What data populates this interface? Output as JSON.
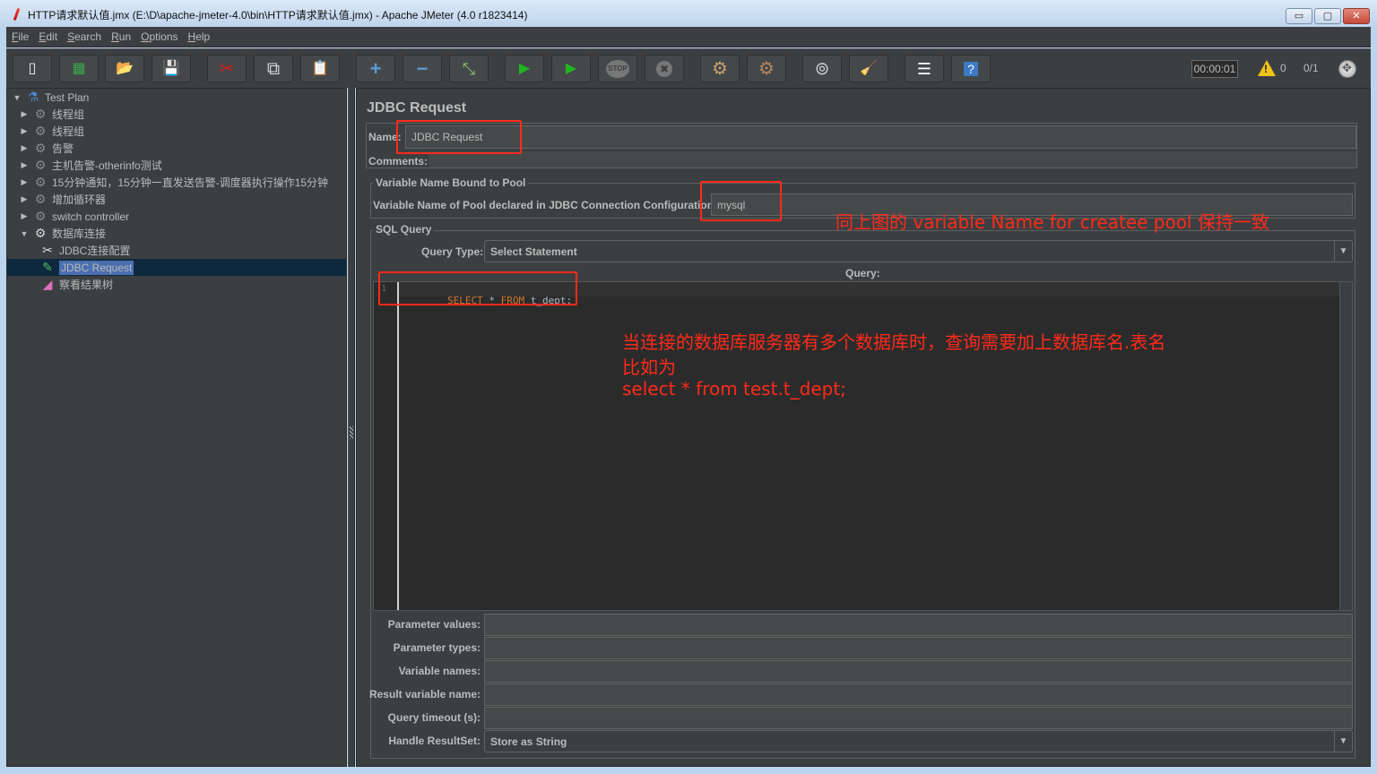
{
  "window": {
    "title": "HTTP请求默认值.jmx (E:\\D\\apache-jmeter-4.0\\bin\\HTTP请求默认值.jmx) - Apache JMeter (4.0 r1823414)",
    "controls": {
      "minimize": "▭",
      "maximize": "▢",
      "close": "✕"
    }
  },
  "menubar": {
    "items": [
      {
        "mnemonic": "F",
        "rest": "ile"
      },
      {
        "mnemonic": "E",
        "rest": "dit"
      },
      {
        "mnemonic": "S",
        "rest": "earch"
      },
      {
        "mnemonic": "R",
        "rest": "un"
      },
      {
        "mnemonic": "O",
        "rest": "ptions"
      },
      {
        "mnemonic": "H",
        "rest": "elp"
      }
    ]
  },
  "toolbar": {
    "buttons": [
      {
        "name": "new-icon",
        "glyph": "▯"
      },
      {
        "name": "templates-icon",
        "glyph": "▦"
      },
      {
        "name": "open-icon",
        "glyph": "📂"
      },
      {
        "name": "save-icon",
        "glyph": "💾"
      },
      {
        "name": "cut-icon",
        "glyph": "✂"
      },
      {
        "name": "copy-icon",
        "glyph": "⧉"
      },
      {
        "name": "paste-icon",
        "glyph": "📋"
      },
      {
        "name": "expand-icon",
        "glyph": "+"
      },
      {
        "name": "collapse-icon",
        "glyph": "−"
      },
      {
        "name": "toggle-icon",
        "glyph": "⤡"
      },
      {
        "name": "start-icon",
        "glyph": "▶"
      },
      {
        "name": "start-no-pauses-icon",
        "glyph": "▶"
      },
      {
        "name": "stop-icon",
        "glyph": "STOP"
      },
      {
        "name": "shutdown-icon",
        "glyph": "✖"
      },
      {
        "name": "clear-icon",
        "glyph": "⚙"
      },
      {
        "name": "clear-all-icon",
        "glyph": "⚙"
      },
      {
        "name": "search-icon",
        "glyph": "⊚"
      },
      {
        "name": "reset-search-icon",
        "glyph": "🧹"
      },
      {
        "name": "function-helper-icon",
        "glyph": "☰"
      },
      {
        "name": "help-icon",
        "glyph": "?"
      }
    ],
    "timer": "00:00:01",
    "warning_count": "0",
    "threads": "0/1"
  },
  "tree": {
    "items": [
      {
        "label": "Test Plan",
        "level": 0,
        "toggle": "▼",
        "icon": "flask-icon"
      },
      {
        "label": "线程组",
        "level": 1,
        "toggle": "▶",
        "icon": "gear-icon"
      },
      {
        "label": "线程组",
        "level": 1,
        "toggle": "▶",
        "icon": "gear-icon"
      },
      {
        "label": "告警",
        "level": 1,
        "toggle": "▶",
        "icon": "gear-icon"
      },
      {
        "label": "主机告警-otherinfo测试",
        "level": 1,
        "toggle": "▶",
        "icon": "gear-icon"
      },
      {
        "label": "15分钟通知，15分钟一直发送告警-调度器执行操作15分钟",
        "level": 1,
        "toggle": "▶",
        "icon": "gear-icon"
      },
      {
        "label": "增加循环器",
        "level": 1,
        "toggle": "▶",
        "icon": "gear-icon"
      },
      {
        "label": "switch controller",
        "level": 1,
        "toggle": "▶",
        "icon": "gear-icon"
      },
      {
        "label": "数据库连接",
        "level": 1,
        "toggle": "▼",
        "icon": "gear-icon"
      },
      {
        "label": "JDBC连接配置",
        "level": 2,
        "toggle": "",
        "icon": "wrench-icon"
      },
      {
        "label": "JDBC Request",
        "level": 2,
        "toggle": "",
        "icon": "pipette-icon",
        "selected": true
      },
      {
        "label": "察看结果树",
        "level": 2,
        "toggle": "",
        "icon": "chart-icon"
      }
    ]
  },
  "form": {
    "title": "JDBC Request",
    "name_label": "Name:",
    "name_value": "JDBC Request",
    "comments_label": "Comments:",
    "comments_value": "",
    "pool_section": "Variable Name Bound to Pool",
    "pool_label": "Variable Name of Pool declared in JDBC Connection Configuration:",
    "pool_value": "mysql",
    "sql_section": "SQL Query",
    "query_type_label": "Query Type:",
    "query_type_value": "Select Statement",
    "query_label": "Query:",
    "query_line_number": "1",
    "query_tokens": [
      {
        "text": "SELECT",
        "type": "kw"
      },
      {
        "text": " * ",
        "type": "plain"
      },
      {
        "text": "FROM",
        "type": "kw"
      },
      {
        "text": " t_dept;",
        "type": "plain"
      }
    ],
    "params": [
      {
        "label": "Parameter values:",
        "value": ""
      },
      {
        "label": "Parameter types:",
        "value": ""
      },
      {
        "label": "Variable names:",
        "value": ""
      },
      {
        "label": "Result variable name:",
        "value": ""
      },
      {
        "label": "Query timeout (s):",
        "value": ""
      }
    ],
    "handle_resultset_label": "Handle ResultSet:",
    "handle_resultset_value": "Store as String"
  },
  "annotations": {
    "pool_note": "同上图的 variable Name for createe pool 保持一致",
    "query_note_lines": [
      "当连接的数据库服务器有多个数据库时，查询需要加上数据库名.表名",
      "比如为",
      "select * from test.t_dept;"
    ],
    "color": "#ff2a1a"
  }
}
